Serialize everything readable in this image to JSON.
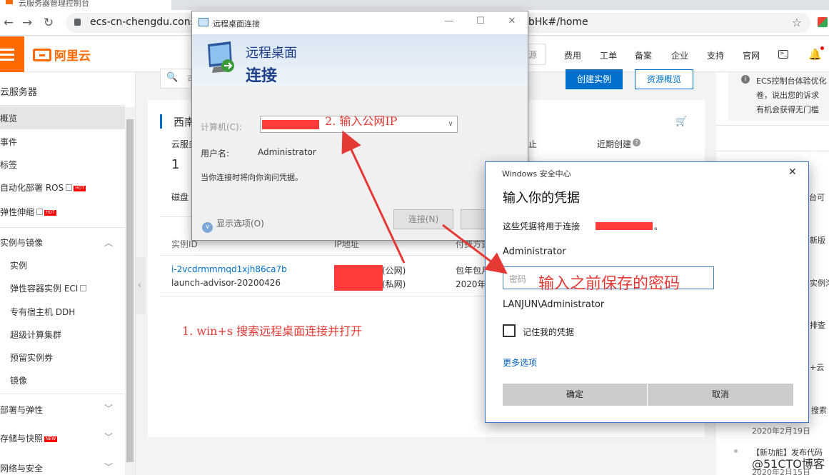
{
  "browser": {
    "tab_title": "云服务器管理控制台",
    "url_left": "ecs-cn-chengdu.cons",
    "url_right": "bHk#/home"
  },
  "aliyun": {
    "logo_text": "阿里云",
    "search_placeholder": "源",
    "nav": [
      "费用",
      "工单",
      "备案",
      "企业",
      "支持",
      "官网"
    ]
  },
  "sidebar": {
    "title": "云服务器",
    "overview": "概览",
    "items": [
      "事件",
      "标签",
      "自动化部署 ROS",
      "弹性伸缩"
    ],
    "group1": "实例与镜像",
    "group1_items": [
      "实例",
      "弹性容器实例 ECI",
      "专有宿主机 DDH",
      "超级计算集群",
      "预留实例券",
      "镜像"
    ],
    "group2": "部署与弹性",
    "group3": "存储与快照",
    "group4": "网络与安全",
    "hot_badge": "HOT",
    "new_badge": "NEW"
  },
  "main": {
    "search_hint": "可",
    "create_button": "创建实例",
    "overview_button": "资源概览",
    "region": "西南",
    "stat_label1": "云服务",
    "stat_value1": "1",
    "stat_label2": "磁盘",
    "stat_label3": "止",
    "stat_label4": "近期创建",
    "col_instance": "实例ID",
    "col_ip": "IP地址",
    "col_pay": "付费方式",
    "instance_id": "i-2vcdrmmmqd1xjh86ca7b",
    "instance_name": "launch-advisor-20200426",
    "ip_public": "(公网)",
    "ip_private": "(私网)",
    "pay1": "包年包月",
    "pay2": "2020年5",
    "annotation1": "1. win+s 搜索远程桌面连接并打开"
  },
  "right_panel": {
    "notice_line1": "ECS控制台体验优化",
    "notice_line2": "卷，说出您的诉求",
    "notice_link": "有机会获得无门槛",
    "items": [
      "台可",
      "新版",
      "实例沟",
      "排查",
      "+云",
      "搜索"
    ],
    "news_date1": "2020年2月19日",
    "news_title2": "【新功能】发布代码",
    "news_date2": "2020年2月15日"
  },
  "rdp": {
    "title": "远程桌面连接",
    "header_line1": "远程桌面",
    "header_line2": "连接",
    "computer_label": "计算机(C):",
    "username_label": "用户名:",
    "username_value": "Administrator",
    "prompt_note": "当你连接时将向你询问凭据。",
    "show_options": "显示选项(O)",
    "connect_button": "连接(N)",
    "help_button": "帮",
    "annotation2": "2. 输入公网IP"
  },
  "winsec": {
    "title": "Windows 安全中心",
    "heading": "输入你的凭据",
    "connect_text": "这些凭据将用于连接",
    "account": "Administrator",
    "password_placeholder": "密码",
    "annotation3": "输入之前保存的密码",
    "domain_user": "LANJUN\\Administrator",
    "remember": "记住我的凭据",
    "more_options": "更多选项",
    "ok_button": "确定",
    "cancel_button": "取消"
  },
  "watermark": "@51CTO博客",
  "colors": {
    "aliyun_orange": "#ff6a00",
    "primary_blue": "#0070cc",
    "annotation_red": "#e53935"
  }
}
